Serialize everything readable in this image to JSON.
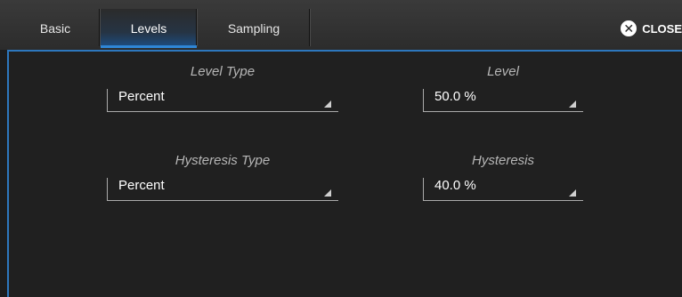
{
  "tabs": [
    {
      "label": "Basic",
      "active": false
    },
    {
      "label": "Levels",
      "active": true
    },
    {
      "label": "Sampling",
      "active": false
    }
  ],
  "close_label": "CLOSE",
  "close_icon": "x-circle-icon",
  "fields": {
    "level_type": {
      "label": "Level Type",
      "value": "Percent"
    },
    "level": {
      "label": "Level",
      "value": "50.0 %"
    },
    "hysteresis_type": {
      "label": "Hysteresis Type",
      "value": "Percent"
    },
    "hysteresis": {
      "label": "Hysteresis",
      "value": "40.0 %"
    }
  },
  "colors": {
    "accent": "#2d77bd",
    "background": "#1d1d1d",
    "text": "#ffffff",
    "label": "#b6b6b6"
  }
}
